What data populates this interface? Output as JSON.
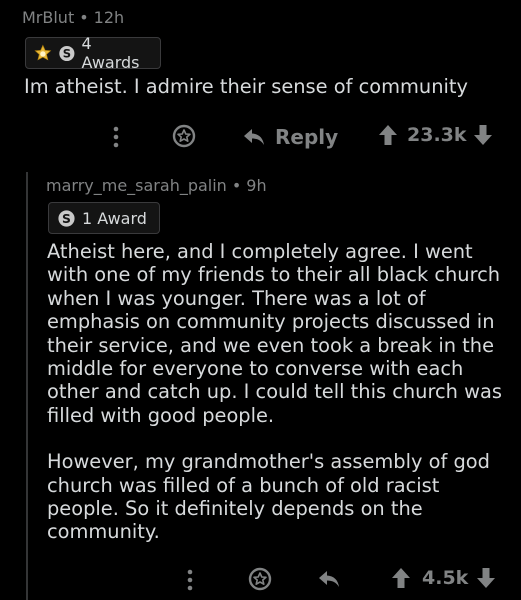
{
  "comment1": {
    "username": "MrBlut",
    "time": "12h",
    "awards_label": "4 Awards",
    "body": "Im atheist. I admire their sense of community",
    "reply_label": "Reply",
    "vote_count": "23.3k"
  },
  "comment2": {
    "username": "marry_me_sarah_palin",
    "time": "9h",
    "awards_label": "1 Award",
    "paragraphs": [
      "Atheist here, and I completely agree. I went with one of my friends to their all black church when I was younger. There was a lot of emphasis on community projects discussed in their service, and we even took a break in the middle for everyone to converse with each other and catch up. I could tell this church was filled with good people.",
      "However, my grandmother's assembly of god church was filled of a bunch of old racist people. So it definitely depends on the community."
    ],
    "vote_count": "4.5k"
  },
  "colors": {
    "background": "#000000",
    "text": "#d7dadc",
    "meta": "#818384",
    "award_gold": "#e8b93b",
    "award_silver": "#c9c9c9",
    "thread_line": "#343536"
  },
  "icons": {
    "more": "more-options-icon",
    "award": "award-icon",
    "reply": "reply-arrow-icon",
    "upvote": "upvote-arrow-icon",
    "downvote": "downvote-arrow-icon"
  }
}
